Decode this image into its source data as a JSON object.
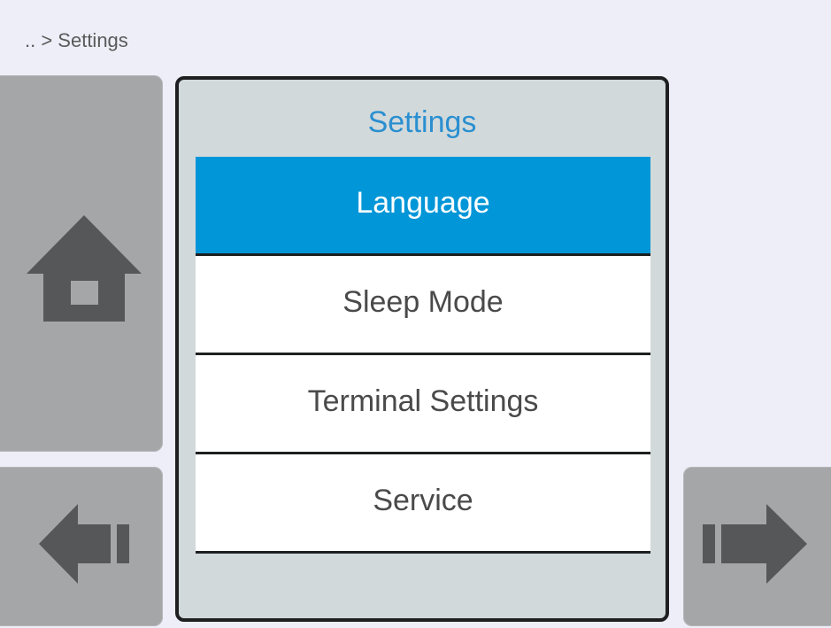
{
  "breadcrumb": ".. > Settings",
  "panel": {
    "title": "Settings"
  },
  "menu": {
    "items": [
      {
        "label": "Language",
        "selected": true
      },
      {
        "label": "Sleep Mode",
        "selected": false
      },
      {
        "label": "Terminal Settings",
        "selected": false
      },
      {
        "label": "Service",
        "selected": false
      }
    ]
  },
  "nav": {
    "home_icon": "home-icon",
    "back_icon": "arrow-left-icon",
    "next_icon": "arrow-right-icon"
  },
  "colors": {
    "background": "#eeeef9",
    "side_button": "#a4a6a8",
    "icon": "#555758",
    "panel": "#d2d9db",
    "panel_border": "#1e1f21",
    "title": "#2a8fd0",
    "selected_item": "#0096d8",
    "item_background": "#ffffff",
    "item_text": "#4a4a4a"
  }
}
